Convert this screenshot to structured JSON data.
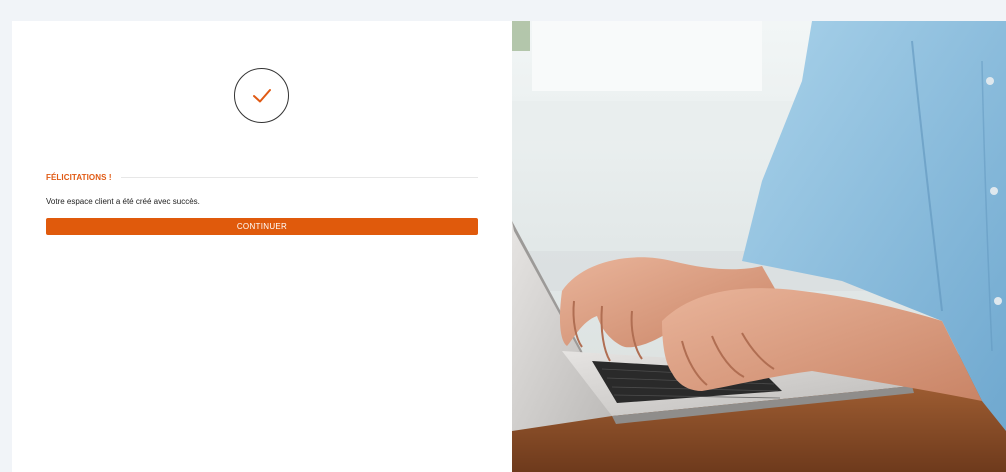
{
  "confirmation": {
    "title": "FÉLICITATIONS !",
    "message": "Votre espace client a été créé avec succès.",
    "continue_label": "CONTINUER"
  },
  "colors": {
    "accent": "#e05a0c",
    "title": "#e05a14",
    "page_background": "#f1f4f8"
  },
  "icons": {
    "status": "checkmark-icon"
  }
}
